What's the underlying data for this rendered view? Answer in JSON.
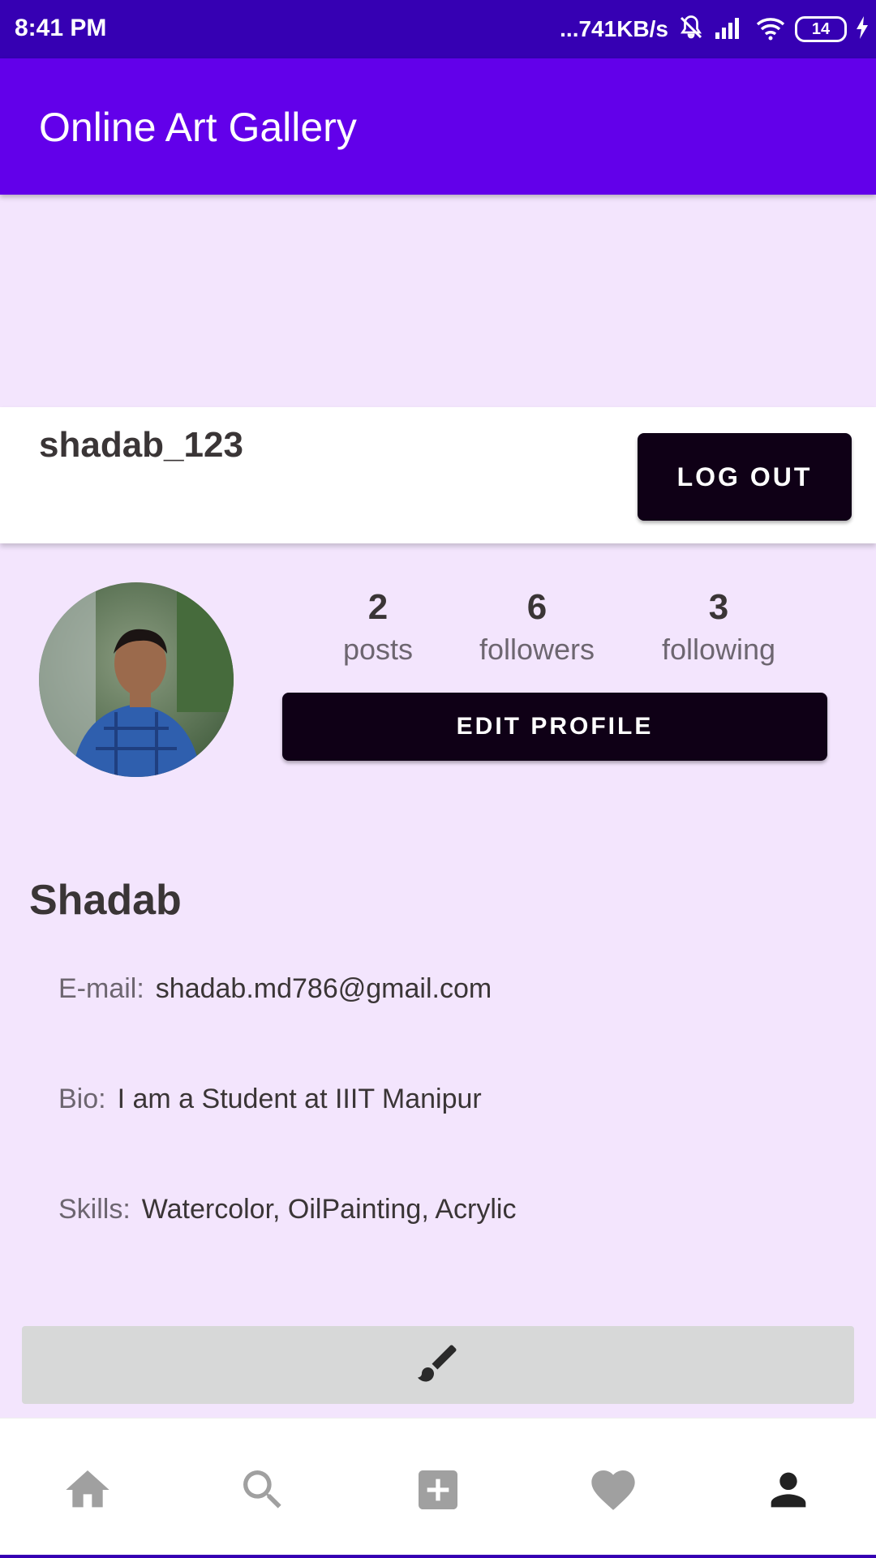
{
  "status_bar": {
    "time": "8:41 PM",
    "network_speed": "...741KB/s",
    "battery": "14",
    "icons": [
      "mute-icon",
      "signal-icon",
      "wifi-icon",
      "battery-icon",
      "charging-icon"
    ]
  },
  "app_bar": {
    "title": "Online Art Gallery"
  },
  "profile_header": {
    "username": "shadab_123",
    "logout_label": "LOG OUT"
  },
  "stats": {
    "posts": {
      "value": "2",
      "label": "posts"
    },
    "followers": {
      "value": "6",
      "label": "followers"
    },
    "following": {
      "value": "3",
      "label": "following"
    }
  },
  "edit_profile_label": "EDIT PROFILE",
  "details": {
    "full_name": "Shadab",
    "email": {
      "label": "E-mail:",
      "value": "shadab.md786@gmail.com"
    },
    "bio": {
      "label": "Bio:",
      "value": "I am a Student at IIIT Manipur"
    },
    "skills": {
      "label": "Skills:",
      "value": "Watercolor, OilPainting, Acrylic"
    }
  },
  "artworks_tab_icon": "paintbrush-icon",
  "bottom_nav": {
    "items": [
      "home-icon",
      "search-icon",
      "add-icon",
      "heart-icon",
      "person-icon"
    ],
    "active": "person-icon"
  },
  "colors": {
    "status_bar": "#3600b3",
    "app_bar": "#6200ea",
    "background": "#f3e5fd",
    "button": "#0f0016",
    "nav_inactive": "#a0a0a0",
    "nav_active": "#222222"
  }
}
